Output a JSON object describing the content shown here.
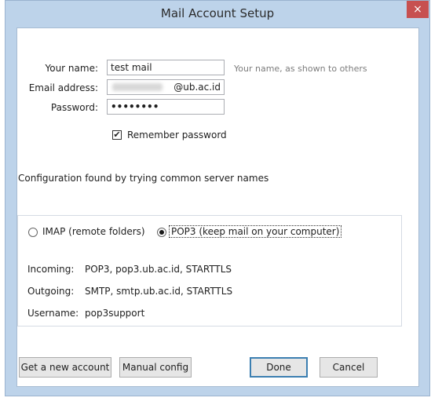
{
  "window": {
    "title": "Mail Account Setup",
    "close_glyph": "×"
  },
  "form": {
    "name_label": "Your name:",
    "name_value": "test mail",
    "name_hint": "Your name, as shown to others",
    "email_label": "Email address:",
    "email_value": "@ub.ac.id",
    "password_label": "Password:",
    "password_value": "••••••••",
    "remember_label": "Remember password",
    "remember_checked": true
  },
  "status": {
    "message": "Configuration found by trying common server names"
  },
  "protocol": {
    "imap_label": "IMAP (remote folders)",
    "pop3_label": "POP3 (keep mail on your computer)",
    "selected": "pop3"
  },
  "details": {
    "incoming_label": "Incoming:",
    "incoming_value": "POP3, pop3.ub.ac.id, STARTTLS",
    "outgoing_label": "Outgoing:",
    "outgoing_value": "SMTP, smtp.ub.ac.id, STARTTLS",
    "username_label": "Username:",
    "username_value": "pop3support"
  },
  "buttons": {
    "get_account": "Get a new account",
    "manual_config": "Manual config",
    "done": "Done",
    "cancel": "Cancel"
  },
  "colors": {
    "frame": "#bdd3ea",
    "close": "#c75050",
    "default_button_border": "#3c7fb1"
  }
}
